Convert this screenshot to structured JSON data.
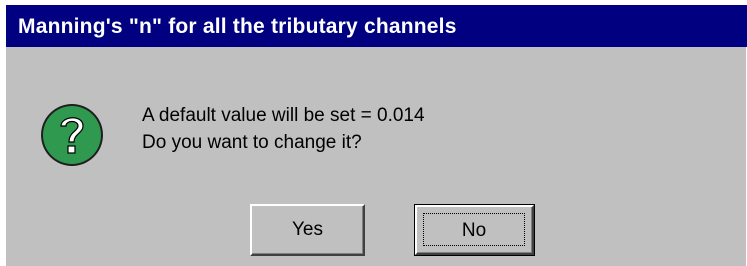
{
  "dialog": {
    "title": "Manning's \"n\" for all the tributary channels",
    "icon": "question-icon",
    "message_line1": "A default value will be set = 0.014",
    "message_line2": "Do you want to change it?",
    "buttons": {
      "yes_label": "Yes",
      "no_label": "No"
    },
    "colors": {
      "titlebar": "#000080",
      "face": "#c0c0c0",
      "icon_green": "#2f9a4f"
    }
  }
}
